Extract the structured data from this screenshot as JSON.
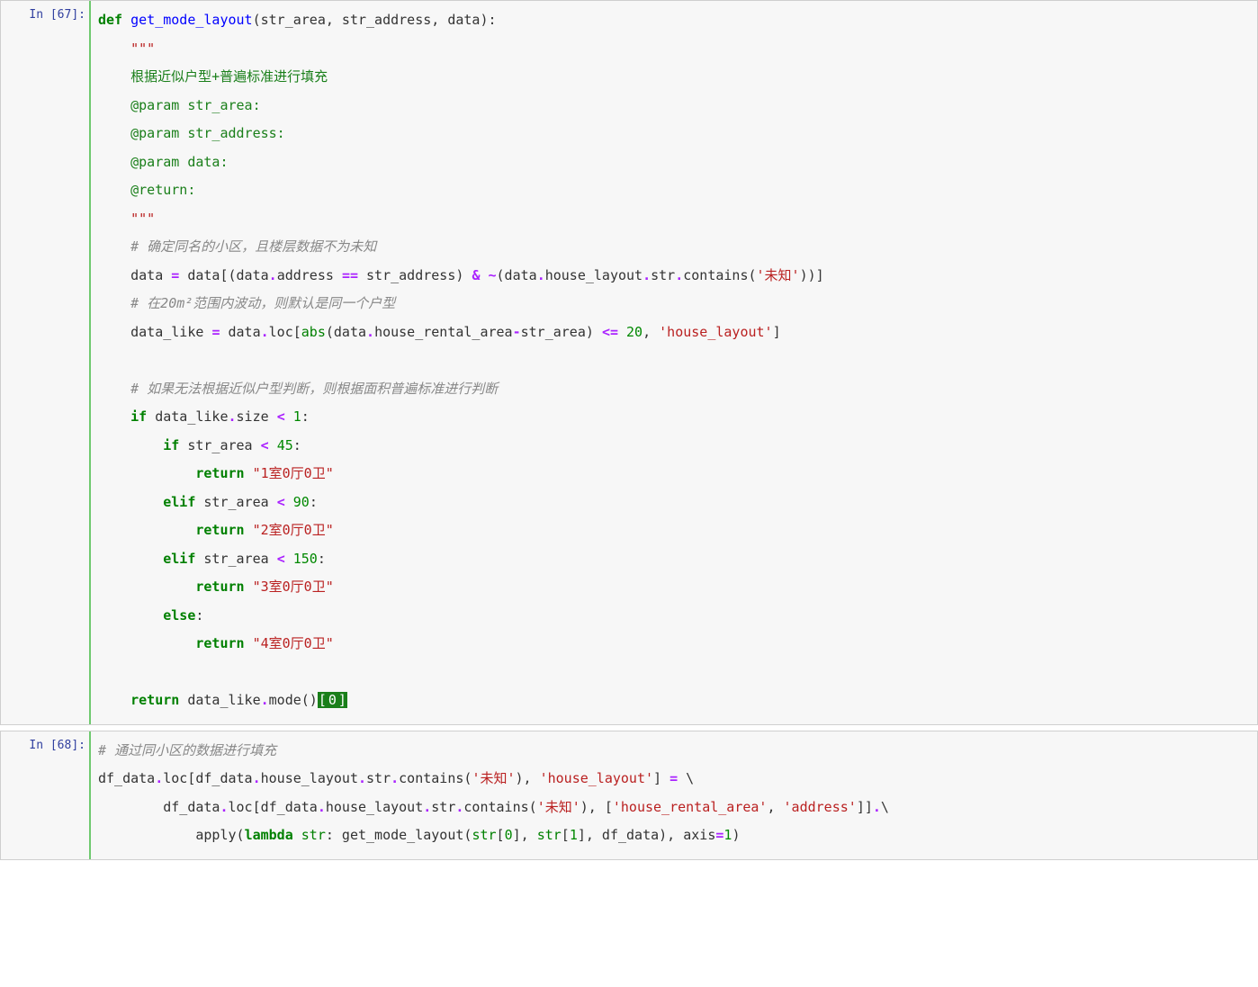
{
  "cells": [
    {
      "prompt": "In [67]:",
      "tokens": [
        {
          "t": "def ",
          "c": "kw"
        },
        {
          "t": "get_mode_layout",
          "c": "fn"
        },
        {
          "t": "(str_area, str_address, data):",
          "c": ""
        },
        {
          "nl": true
        },
        {
          "t": "    ",
          "c": ""
        },
        {
          "t": "\"\"\"",
          "c": "docq"
        },
        {
          "nl": true
        },
        {
          "t": "    ",
          "c": ""
        },
        {
          "t": "根据近似户型+普遍标准进行填充",
          "c": "docline"
        },
        {
          "nl": true
        },
        {
          "t": "    ",
          "c": ""
        },
        {
          "t": "@param str_area:",
          "c": "attr"
        },
        {
          "nl": true
        },
        {
          "t": "    ",
          "c": ""
        },
        {
          "t": "@param str_address:",
          "c": "attr"
        },
        {
          "nl": true
        },
        {
          "t": "    ",
          "c": ""
        },
        {
          "t": "@param data:",
          "c": "attr"
        },
        {
          "nl": true
        },
        {
          "t": "    ",
          "c": ""
        },
        {
          "t": "@return:",
          "c": "attr"
        },
        {
          "nl": true
        },
        {
          "t": "    ",
          "c": ""
        },
        {
          "t": "\"\"\"",
          "c": "docq"
        },
        {
          "nl": true
        },
        {
          "t": "    ",
          "c": ""
        },
        {
          "t": "# 确定同名的小区，且楼层数据不为未知",
          "c": "comment"
        },
        {
          "nl": true
        },
        {
          "t": "    data ",
          "c": ""
        },
        {
          "t": "=",
          "c": "op"
        },
        {
          "t": " data[(data",
          "c": ""
        },
        {
          "t": ".",
          "c": "op"
        },
        {
          "t": "address ",
          "c": ""
        },
        {
          "t": "==",
          "c": "op"
        },
        {
          "t": " str_address) ",
          "c": ""
        },
        {
          "t": "&",
          "c": "op"
        },
        {
          "t": " ",
          "c": ""
        },
        {
          "t": "~",
          "c": "op"
        },
        {
          "t": "(data",
          "c": ""
        },
        {
          "t": ".",
          "c": "op"
        },
        {
          "t": "house_layout",
          "c": ""
        },
        {
          "t": ".",
          "c": "op"
        },
        {
          "t": "str",
          "c": ""
        },
        {
          "t": ".",
          "c": "op"
        },
        {
          "t": "contains(",
          "c": ""
        },
        {
          "t": "'未知'",
          "c": "str"
        },
        {
          "t": "))]",
          "c": ""
        },
        {
          "nl": true
        },
        {
          "t": "    ",
          "c": ""
        },
        {
          "t": "# 在20m²范围内波动，则默认是同一个户型",
          "c": "comment"
        },
        {
          "nl": true
        },
        {
          "t": "    data_like ",
          "c": ""
        },
        {
          "t": "=",
          "c": "op"
        },
        {
          "t": " data",
          "c": ""
        },
        {
          "t": ".",
          "c": "op"
        },
        {
          "t": "loc[",
          "c": ""
        },
        {
          "t": "abs",
          "c": "builtin"
        },
        {
          "t": "(data",
          "c": ""
        },
        {
          "t": ".",
          "c": "op"
        },
        {
          "t": "house_rental_area",
          "c": ""
        },
        {
          "t": "-",
          "c": "op"
        },
        {
          "t": "str_area) ",
          "c": ""
        },
        {
          "t": "<=",
          "c": "op"
        },
        {
          "t": " ",
          "c": ""
        },
        {
          "t": "20",
          "c": "num"
        },
        {
          "t": ", ",
          "c": ""
        },
        {
          "t": "'house_layout'",
          "c": "str"
        },
        {
          "t": "]",
          "c": ""
        },
        {
          "nl": true
        },
        {
          "nl": true
        },
        {
          "t": "    ",
          "c": ""
        },
        {
          "t": "# 如果无法根据近似户型判断，则根据面积普遍标准进行判断",
          "c": "comment"
        },
        {
          "nl": true
        },
        {
          "t": "    ",
          "c": ""
        },
        {
          "t": "if",
          "c": "kw"
        },
        {
          "t": " data_like",
          "c": ""
        },
        {
          "t": ".",
          "c": "op"
        },
        {
          "t": "size ",
          "c": ""
        },
        {
          "t": "<",
          "c": "op"
        },
        {
          "t": " ",
          "c": ""
        },
        {
          "t": "1",
          "c": "num"
        },
        {
          "t": ":",
          "c": ""
        },
        {
          "nl": true
        },
        {
          "t": "        ",
          "c": ""
        },
        {
          "t": "if",
          "c": "kw"
        },
        {
          "t": " str_area ",
          "c": ""
        },
        {
          "t": "<",
          "c": "op"
        },
        {
          "t": " ",
          "c": ""
        },
        {
          "t": "45",
          "c": "num"
        },
        {
          "t": ":",
          "c": ""
        },
        {
          "nl": true
        },
        {
          "t": "            ",
          "c": ""
        },
        {
          "t": "return",
          "c": "kw"
        },
        {
          "t": " ",
          "c": ""
        },
        {
          "t": "\"1室0厅0卫\"",
          "c": "str"
        },
        {
          "nl": true
        },
        {
          "t": "        ",
          "c": ""
        },
        {
          "t": "elif",
          "c": "kw"
        },
        {
          "t": " str_area ",
          "c": ""
        },
        {
          "t": "<",
          "c": "op"
        },
        {
          "t": " ",
          "c": ""
        },
        {
          "t": "90",
          "c": "num"
        },
        {
          "t": ":",
          "c": ""
        },
        {
          "nl": true
        },
        {
          "t": "            ",
          "c": ""
        },
        {
          "t": "return",
          "c": "kw"
        },
        {
          "t": " ",
          "c": ""
        },
        {
          "t": "\"2室0厅0卫\"",
          "c": "str"
        },
        {
          "nl": true
        },
        {
          "t": "        ",
          "c": ""
        },
        {
          "t": "elif",
          "c": "kw"
        },
        {
          "t": " str_area ",
          "c": ""
        },
        {
          "t": "<",
          "c": "op"
        },
        {
          "t": " ",
          "c": ""
        },
        {
          "t": "150",
          "c": "num"
        },
        {
          "t": ":",
          "c": ""
        },
        {
          "nl": true
        },
        {
          "t": "            ",
          "c": ""
        },
        {
          "t": "return",
          "c": "kw"
        },
        {
          "t": " ",
          "c": ""
        },
        {
          "t": "\"3室0厅0卫\"",
          "c": "str"
        },
        {
          "nl": true
        },
        {
          "t": "        ",
          "c": ""
        },
        {
          "t": "else",
          "c": "kw"
        },
        {
          "t": ":",
          "c": ""
        },
        {
          "nl": true
        },
        {
          "t": "            ",
          "c": ""
        },
        {
          "t": "return",
          "c": "kw"
        },
        {
          "t": " ",
          "c": ""
        },
        {
          "t": "\"4室0厅0卫\"",
          "c": "str"
        },
        {
          "nl": true
        },
        {
          "nl": true
        },
        {
          "t": "    ",
          "c": ""
        },
        {
          "t": "return",
          "c": "kw"
        },
        {
          "t": " data_like",
          "c": ""
        },
        {
          "t": ".",
          "c": "op"
        },
        {
          "t": "mode()",
          "c": ""
        },
        {
          "t": "[",
          "c": "sel"
        },
        {
          "t": "0",
          "c": "sel"
        },
        {
          "t": "]",
          "c": "sel"
        }
      ]
    },
    {
      "prompt": "In [68]:",
      "tokens": [
        {
          "t": "# 通过同小区的数据进行填充",
          "c": "comment"
        },
        {
          "nl": true
        },
        {
          "t": "df_data",
          "c": ""
        },
        {
          "t": ".",
          "c": "op"
        },
        {
          "t": "loc[df_data",
          "c": ""
        },
        {
          "t": ".",
          "c": "op"
        },
        {
          "t": "house_layout",
          "c": ""
        },
        {
          "t": ".",
          "c": "op"
        },
        {
          "t": "str",
          "c": ""
        },
        {
          "t": ".",
          "c": "op"
        },
        {
          "t": "contains(",
          "c": ""
        },
        {
          "t": "'未知'",
          "c": "str"
        },
        {
          "t": "), ",
          "c": ""
        },
        {
          "t": "'house_layout'",
          "c": "str"
        },
        {
          "t": "] ",
          "c": ""
        },
        {
          "t": "=",
          "c": "op"
        },
        {
          "t": " \\",
          "c": ""
        },
        {
          "nl": true
        },
        {
          "t": "        df_data",
          "c": ""
        },
        {
          "t": ".",
          "c": "op"
        },
        {
          "t": "loc[df_data",
          "c": ""
        },
        {
          "t": ".",
          "c": "op"
        },
        {
          "t": "house_layout",
          "c": ""
        },
        {
          "t": ".",
          "c": "op"
        },
        {
          "t": "str",
          "c": ""
        },
        {
          "t": ".",
          "c": "op"
        },
        {
          "t": "contains(",
          "c": ""
        },
        {
          "t": "'未知'",
          "c": "str"
        },
        {
          "t": "), [",
          "c": ""
        },
        {
          "t": "'house_rental_area'",
          "c": "str"
        },
        {
          "t": ", ",
          "c": ""
        },
        {
          "t": "'address'",
          "c": "str"
        },
        {
          "t": "]]",
          "c": ""
        },
        {
          "t": ".",
          "c": "op"
        },
        {
          "t": "\\",
          "c": ""
        },
        {
          "nl": true
        },
        {
          "t": "            apply(",
          "c": ""
        },
        {
          "t": "lambda",
          "c": "kw"
        },
        {
          "t": " ",
          "c": ""
        },
        {
          "t": "str",
          "c": "builtin"
        },
        {
          "t": ": get_mode_layout(",
          "c": ""
        },
        {
          "t": "str",
          "c": "builtin"
        },
        {
          "t": "[",
          "c": ""
        },
        {
          "t": "0",
          "c": "num"
        },
        {
          "t": "], ",
          "c": ""
        },
        {
          "t": "str",
          "c": "builtin"
        },
        {
          "t": "[",
          "c": ""
        },
        {
          "t": "1",
          "c": "num"
        },
        {
          "t": "], df_data), axis",
          "c": ""
        },
        {
          "t": "=",
          "c": "op"
        },
        {
          "t": "1",
          "c": "num"
        },
        {
          "t": ")",
          "c": ""
        }
      ]
    }
  ]
}
